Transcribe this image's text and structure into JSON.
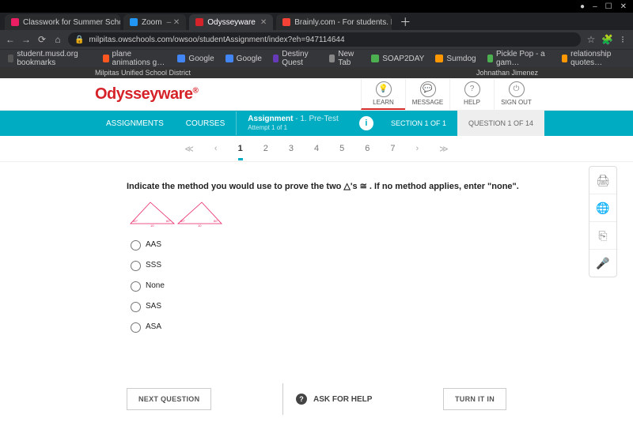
{
  "browser": {
    "window_controls": [
      "–",
      "☐",
      "✕"
    ],
    "tabs": [
      {
        "fav_color": "#e91e63",
        "label": "Classwork for Summer School M",
        "close": "✕"
      },
      {
        "fav_color": "#2196f3",
        "label": "Zoom",
        "close": "– ✕"
      },
      {
        "fav_color": "#d6232a",
        "label": "Odysseyware",
        "close": "✕"
      },
      {
        "fav_color": "#f44336",
        "label": "Brainly.com - For students. By st",
        "close": "✕"
      }
    ],
    "active_tab": 2,
    "newtab": "＋",
    "nav": {
      "back": "←",
      "fwd": "→",
      "reload": "⟳",
      "home": "⌂",
      "lock": "🔒"
    },
    "url": "milpitas.owschools.com/owsoo/studentAssignment/index?eh=947114644",
    "right_icons": [
      "☆",
      "⁝",
      "🧩"
    ],
    "bookmarks": [
      {
        "color": "#555",
        "label": "student.musd.org bookmarks"
      },
      {
        "color": "#ff5722",
        "label": "plane animations g…"
      },
      {
        "color": "#4285f4",
        "label": "Google"
      },
      {
        "color": "#4285f4",
        "label": "Google"
      },
      {
        "color": "#673ab7",
        "label": "Destiny Quest"
      },
      {
        "color": "#888",
        "label": "New Tab"
      },
      {
        "color": "#4caf50",
        "label": "SOAP2DAY"
      },
      {
        "color": "#ff9800",
        "label": "Sumdog"
      },
      {
        "color": "#4caf50",
        "label": "Pickle Pop - a gam…"
      },
      {
        "color": "#ff9800",
        "label": "relationship quotes…"
      }
    ]
  },
  "page": {
    "district": "Milpitas Unified School District",
    "student": "Johnathan Jimenez",
    "logo": "Odysseyware",
    "tools": [
      {
        "icon": "💡",
        "label": "LEARN",
        "active": true
      },
      {
        "icon": "💬",
        "label": "MESSAGE"
      },
      {
        "icon": "?",
        "label": "HELP"
      },
      {
        "icon": "⏻",
        "label": "SIGN OUT"
      }
    ],
    "nav": {
      "assignments": "ASSIGNMENTS",
      "courses": "COURSES",
      "assignment_label": "Assignment",
      "assignment_name": "- 1. Pre-Test",
      "attempt": "Attempt 1 of 1",
      "section": "SECTION 1 OF 1",
      "question": "QUESTION 1 OF 14"
    },
    "pager": {
      "first": "≪",
      "prev": "‹",
      "nums": [
        "1",
        "2",
        "3",
        "4",
        "5",
        "6",
        "7"
      ],
      "current": 0,
      "next": "›",
      "last": "≫"
    },
    "prompt": "Indicate the method you would use to prove the two △'s ≅ . If no method applies, enter \"none\".",
    "options": [
      "AAS",
      "SSS",
      "None",
      "SAS",
      "ASA"
    ],
    "side": [
      {
        "name": "print-icon",
        "glyph": "🖨"
      },
      {
        "name": "globe-icon",
        "glyph": "🌐"
      },
      {
        "name": "translate-icon",
        "glyph": "⎘"
      },
      {
        "name": "mic-icon",
        "glyph": "🎤"
      }
    ],
    "buttons": {
      "next": "NEXT QUESTION",
      "ask": "ASK FOR HELP",
      "turnin": "TURN IT IN"
    }
  }
}
